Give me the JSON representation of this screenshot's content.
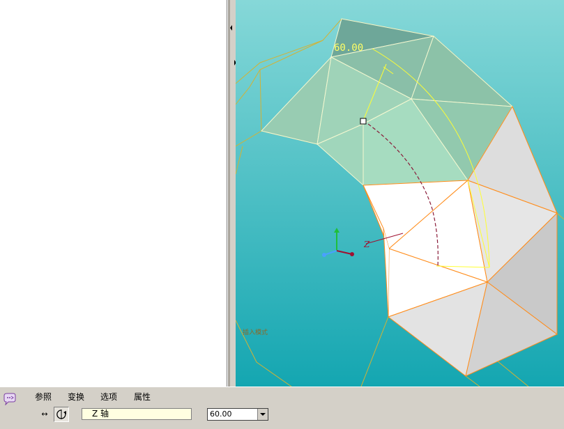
{
  "viewport": {
    "dimension_label": "60.00",
    "axis_label": "Z",
    "watermark": "插入模式",
    "colors": {
      "background_top": "#7fd6d6",
      "background_bottom": "#15a7b2",
      "edge_highlight": "#ff8c1a",
      "preview_fill": "#9ad8b8",
      "wireframe": "#d4b233",
      "dimension": "#ffff33"
    }
  },
  "dashboard": {
    "tabs": [
      "参照",
      "变换",
      "选项",
      "属性"
    ],
    "move_tool_icon": "↔",
    "rotate_tool_icon": "↺",
    "axis_reference": "Z 轴",
    "angle_value": "60.00"
  }
}
